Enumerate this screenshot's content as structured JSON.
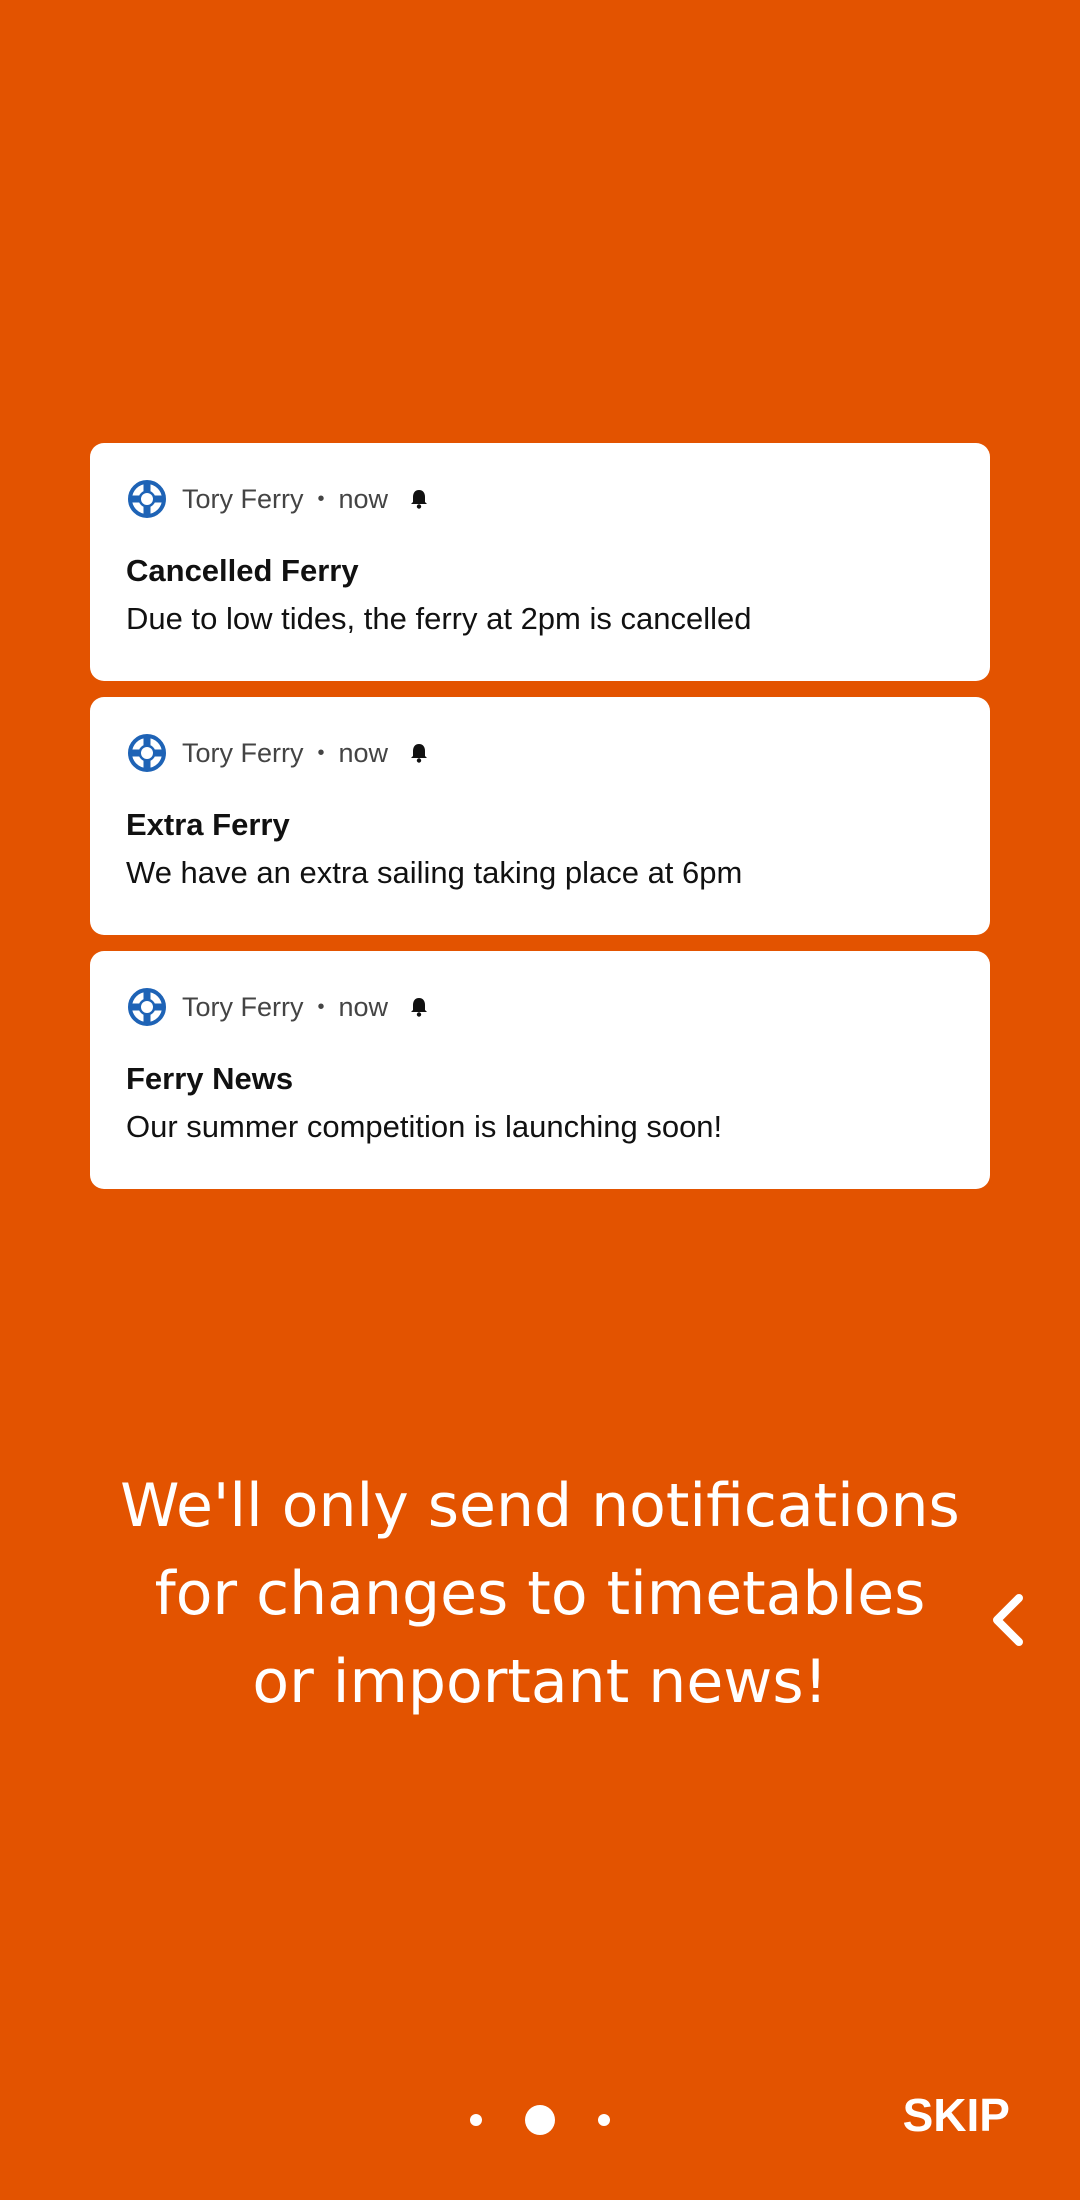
{
  "notifications": [
    {
      "app_name": "Tory Ferry",
      "separator": "•",
      "time": "now",
      "title": "Cancelled Ferry",
      "body": "Due to low tides, the ferry at 2pm is cancelled"
    },
    {
      "app_name": "Tory Ferry",
      "separator": "•",
      "time": "now",
      "title": "Extra Ferry",
      "body": "We have an extra sailing taking place at 6pm"
    },
    {
      "app_name": "Tory Ferry",
      "separator": "•",
      "time": "now",
      "title": "Ferry News",
      "body": "Our summer competition is launching soon!"
    }
  ],
  "message": {
    "line1": "We'll only send notifications",
    "line2": "for changes to timetables",
    "line3": "or important news!"
  },
  "pager": {
    "total": 3,
    "active_index": 1
  },
  "skip_label": "SKIP",
  "colors": {
    "background": "#E35300",
    "card": "#FFFFFF",
    "icon_blue": "#1E63B6",
    "text_white": "#FFFFFF"
  },
  "icons": {
    "app": "lifebuoy-icon",
    "notification": "bell-icon",
    "back": "chevron-left-icon"
  }
}
